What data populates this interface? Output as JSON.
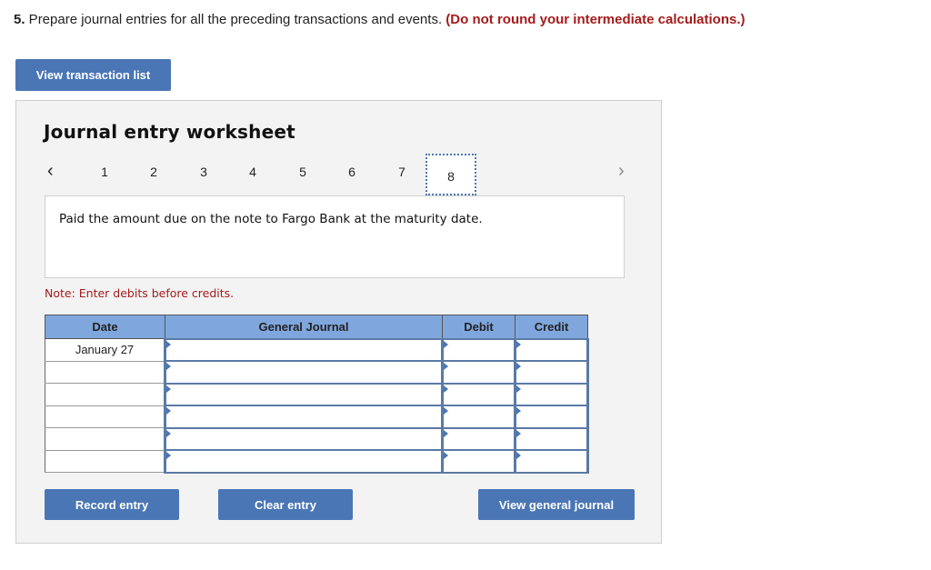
{
  "question": {
    "number": "5.",
    "text": " Prepare journal entries for all the preceding transactions and events. ",
    "warning": "(Do not round your intermediate calculations.)"
  },
  "buttons": {
    "view_transactions": "View transaction list",
    "record_entry": "Record entry",
    "clear_entry": "Clear entry",
    "view_general_journal": "View general journal"
  },
  "worksheet": {
    "title": "Journal entry worksheet",
    "pager": {
      "prev_icon": "‹",
      "next_icon": "›",
      "pages": [
        "1",
        "2",
        "3",
        "4",
        "5",
        "6",
        "7",
        "8"
      ],
      "active_page": "8"
    },
    "description": "Paid the amount due on the note to Fargo Bank at the maturity date.",
    "note": "Note: Enter debits before credits."
  },
  "table": {
    "headers": [
      "Date",
      "General Journal",
      "Debit",
      "Credit"
    ],
    "rows": [
      {
        "date": "January 27",
        "account": "",
        "debit": "",
        "credit": ""
      },
      {
        "date": "",
        "account": "",
        "debit": "",
        "credit": ""
      },
      {
        "date": "",
        "account": "",
        "debit": "",
        "credit": ""
      },
      {
        "date": "",
        "account": "",
        "debit": "",
        "credit": ""
      },
      {
        "date": "",
        "account": "",
        "debit": "",
        "credit": ""
      },
      {
        "date": "",
        "account": "",
        "debit": "",
        "credit": ""
      }
    ]
  }
}
